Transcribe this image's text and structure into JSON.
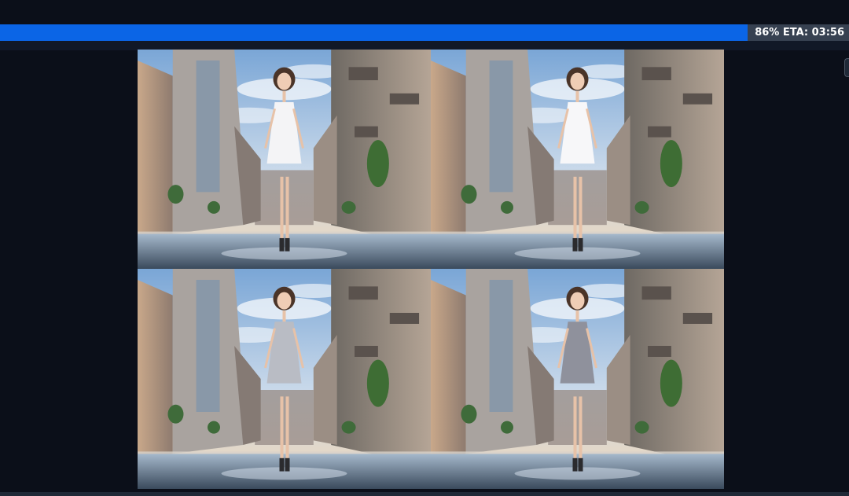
{
  "progress": {
    "percent": 86,
    "label": "86% ETA: 03:56"
  },
  "colors": {
    "background": "#0b0f19",
    "progress_fill": "#0b65e6",
    "progress_track": "#374151"
  },
  "gallery": {
    "images": [
      {
        "dress_color": "#f4f4f6"
      },
      {
        "dress_color": "#f7f7f9"
      },
      {
        "dress_color": "#b9bcc4"
      },
      {
        "dress_color": "#8f919c"
      }
    ]
  }
}
